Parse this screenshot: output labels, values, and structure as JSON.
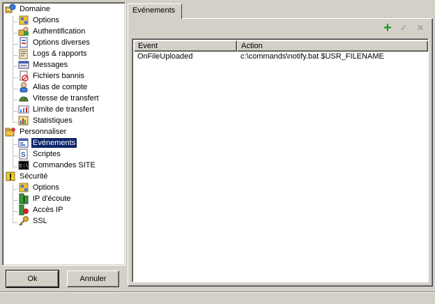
{
  "tree": {
    "items": [
      {
        "label": "Domaine",
        "icon": "domain-icon"
      },
      {
        "label": "Options",
        "icon": "options-icon"
      },
      {
        "label": "Authentification",
        "icon": "auth-icon"
      },
      {
        "label": "Options diverses",
        "icon": "misc-options-icon"
      },
      {
        "label": "Logs & rapports",
        "icon": "logs-icon"
      },
      {
        "label": "Messages",
        "icon": "messages-icon"
      },
      {
        "label": "Fichiers bannis",
        "icon": "banned-files-icon"
      },
      {
        "label": "Alias de compte",
        "icon": "account-alias-icon"
      },
      {
        "label": "Vitesse de transfert",
        "icon": "speedometer-icon"
      },
      {
        "label": "Limite de transfert",
        "icon": "transfer-limit-icon"
      },
      {
        "label": "Statistiques",
        "icon": "statistics-icon"
      },
      {
        "label": "Personnaliser",
        "icon": "customize-icon"
      },
      {
        "label": "Evénements",
        "icon": "events-icon"
      },
      {
        "label": "Scriptes",
        "icon": "scripts-icon"
      },
      {
        "label": "Commandes SITE",
        "icon": "console-icon"
      },
      {
        "label": "Sécurité",
        "icon": "security-icon"
      },
      {
        "label": "Options",
        "icon": "options-icon"
      },
      {
        "label": "IP d'écoute",
        "icon": "listen-ip-icon"
      },
      {
        "label": "Accès IP",
        "icon": "ip-access-icon"
      },
      {
        "label": "SSL",
        "icon": "key-icon"
      }
    ]
  },
  "buttons": {
    "ok": "Ok",
    "cancel": "Annuler"
  },
  "tab": {
    "label": "Evénements"
  },
  "toolbar": {
    "add": "+",
    "edit": "✓",
    "delete": "✕"
  },
  "list": {
    "columns": [
      "Event",
      "Action"
    ],
    "rows": [
      {
        "event": "OnFileUploaded",
        "action": "c:\\commands\\notify.bat $USR_FILENAME"
      }
    ]
  },
  "colors": {
    "selection": "#0a246a",
    "add_green": "#1d9a1d",
    "disabled": "#a0a0a0"
  }
}
